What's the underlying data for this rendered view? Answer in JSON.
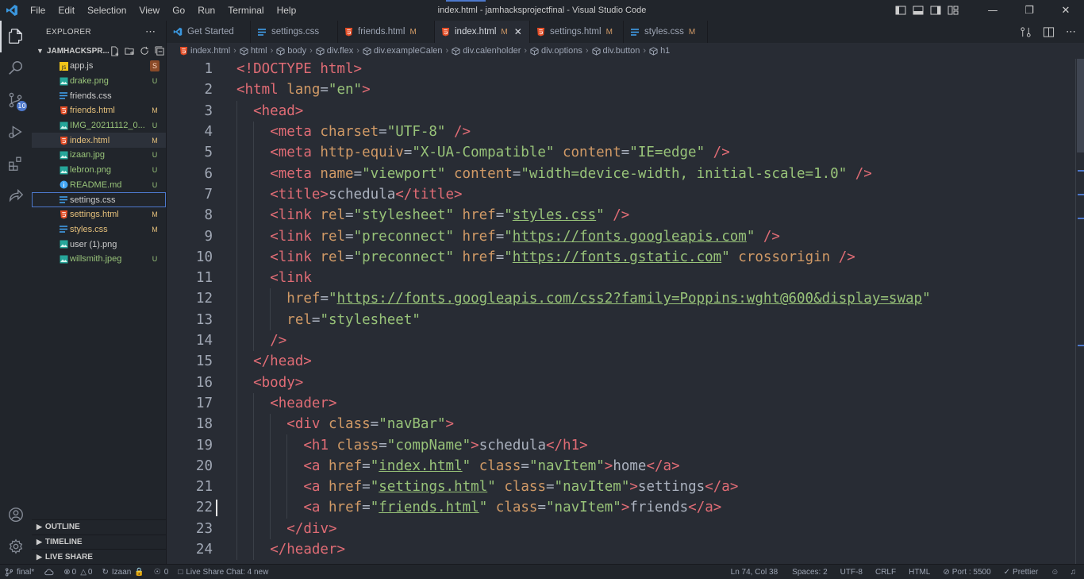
{
  "window": {
    "title": "index.html - jamhacksprojectfinal - Visual Studio Code",
    "menu": [
      "File",
      "Edit",
      "Selection",
      "View",
      "Go",
      "Run",
      "Terminal",
      "Help"
    ]
  },
  "activity": {
    "source_control_badge": "10"
  },
  "sidebar": {
    "title": "EXPLORER",
    "folder": "JAMHACKSPR...",
    "files": [
      {
        "name": "app.js",
        "status": "S",
        "icon": "js-icon",
        "color": "#cccccc"
      },
      {
        "name": "drake.png",
        "status": "U",
        "icon": "image-icon",
        "color": "#98c379"
      },
      {
        "name": "friends.css",
        "status": "",
        "icon": "css-icon",
        "color": "#cccccc"
      },
      {
        "name": "friends.html",
        "status": "M",
        "icon": "html-icon",
        "color": "#e5c07b"
      },
      {
        "name": "IMG_20211112_0...",
        "status": "U",
        "icon": "image-icon",
        "color": "#98c379"
      },
      {
        "name": "index.html",
        "status": "M",
        "icon": "html-icon",
        "color": "#e5c07b"
      },
      {
        "name": "izaan.jpg",
        "status": "U",
        "icon": "image-icon",
        "color": "#98c379"
      },
      {
        "name": "lebron.png",
        "status": "U",
        "icon": "image-icon",
        "color": "#98c379"
      },
      {
        "name": "README.md",
        "status": "U",
        "icon": "info-icon",
        "color": "#98c379"
      },
      {
        "name": "settings.css",
        "status": "",
        "icon": "css-icon",
        "color": "#cccccc"
      },
      {
        "name": "settings.html",
        "status": "M",
        "icon": "html-icon",
        "color": "#e5c07b"
      },
      {
        "name": "styles.css",
        "status": "M",
        "icon": "css-icon",
        "color": "#e5c07b"
      },
      {
        "name": "user (1).png",
        "status": "",
        "icon": "image-icon",
        "color": "#cccccc"
      },
      {
        "name": "willsmith.jpeg",
        "status": "U",
        "icon": "image-icon",
        "color": "#98c379"
      }
    ],
    "sections": [
      "OUTLINE",
      "TIMELINE",
      "LIVE SHARE"
    ]
  },
  "tabs": [
    {
      "label": "Get Started",
      "mod": "",
      "icon": "vscode-icon"
    },
    {
      "label": "settings.css",
      "mod": "",
      "icon": "css-icon"
    },
    {
      "label": "friends.html",
      "mod": "M",
      "icon": "html-icon"
    },
    {
      "label": "index.html",
      "mod": "M",
      "icon": "html-icon",
      "active": true
    },
    {
      "label": "settings.html",
      "mod": "M",
      "icon": "html-icon"
    },
    {
      "label": "styles.css",
      "mod": "M",
      "icon": "css-icon"
    }
  ],
  "breadcrumb": [
    "index.html",
    "html",
    "body",
    "div.flex",
    "div.exampleCalen",
    "div.calenholder",
    "div.options",
    "div.button",
    "h1"
  ],
  "code": [
    {
      "n": "1",
      "i": 0,
      "t": [
        [
          "tag",
          "<!DOCTYPE html>"
        ]
      ]
    },
    {
      "n": "2",
      "i": 0,
      "t": [
        [
          "tag",
          "<html "
        ],
        [
          "attr",
          "lang"
        ],
        [
          "pun",
          "="
        ],
        [
          "str",
          "\"en\""
        ],
        [
          "tag",
          ">"
        ]
      ]
    },
    {
      "n": "3",
      "i": 1,
      "t": [
        [
          "tag",
          "<head>"
        ]
      ]
    },
    {
      "n": "4",
      "i": 2,
      "t": [
        [
          "tag",
          "<meta "
        ],
        [
          "attr",
          "charset"
        ],
        [
          "pun",
          "="
        ],
        [
          "str",
          "\"UTF-8\""
        ],
        [
          "tag",
          " />"
        ]
      ]
    },
    {
      "n": "5",
      "i": 2,
      "t": [
        [
          "tag",
          "<meta "
        ],
        [
          "attr",
          "http-equiv"
        ],
        [
          "pun",
          "="
        ],
        [
          "str",
          "\"X-UA-Compatible\""
        ],
        [
          "pun",
          " "
        ],
        [
          "attr",
          "content"
        ],
        [
          "pun",
          "="
        ],
        [
          "str",
          "\"IE=edge\""
        ],
        [
          "tag",
          " />"
        ]
      ]
    },
    {
      "n": "6",
      "i": 2,
      "t": [
        [
          "tag",
          "<meta "
        ],
        [
          "attr",
          "name"
        ],
        [
          "pun",
          "="
        ],
        [
          "str",
          "\"viewport\""
        ],
        [
          "pun",
          " "
        ],
        [
          "attr",
          "content"
        ],
        [
          "pun",
          "="
        ],
        [
          "str",
          "\"width=device-width, initial-scale=1.0\""
        ],
        [
          "tag",
          " />"
        ]
      ]
    },
    {
      "n": "7",
      "i": 2,
      "t": [
        [
          "tag",
          "<title>"
        ],
        [
          "txt",
          "schedula"
        ],
        [
          "tag",
          "</title>"
        ]
      ]
    },
    {
      "n": "8",
      "i": 2,
      "t": [
        [
          "tag",
          "<link "
        ],
        [
          "attr",
          "rel"
        ],
        [
          "pun",
          "="
        ],
        [
          "str",
          "\"stylesheet\""
        ],
        [
          "pun",
          " "
        ],
        [
          "attr",
          "href"
        ],
        [
          "pun",
          "="
        ],
        [
          "str",
          "\""
        ],
        [
          "strl",
          "styles.css"
        ],
        [
          "str",
          "\""
        ],
        [
          "tag",
          " />"
        ]
      ]
    },
    {
      "n": "9",
      "i": 2,
      "t": [
        [
          "tag",
          "<link "
        ],
        [
          "attr",
          "rel"
        ],
        [
          "pun",
          "="
        ],
        [
          "str",
          "\"preconnect\""
        ],
        [
          "pun",
          " "
        ],
        [
          "attr",
          "href"
        ],
        [
          "pun",
          "="
        ],
        [
          "str",
          "\""
        ],
        [
          "strl",
          "https://fonts.googleapis.com"
        ],
        [
          "str",
          "\""
        ],
        [
          "tag",
          " />"
        ]
      ]
    },
    {
      "n": "10",
      "i": 2,
      "t": [
        [
          "tag",
          "<link "
        ],
        [
          "attr",
          "rel"
        ],
        [
          "pun",
          "="
        ],
        [
          "str",
          "\"preconnect\""
        ],
        [
          "pun",
          " "
        ],
        [
          "attr",
          "href"
        ],
        [
          "pun",
          "="
        ],
        [
          "str",
          "\""
        ],
        [
          "strl",
          "https://fonts.gstatic.com"
        ],
        [
          "str",
          "\""
        ],
        [
          "pun",
          " "
        ],
        [
          "attr",
          "crossorigin"
        ],
        [
          "tag",
          " />"
        ]
      ]
    },
    {
      "n": "11",
      "i": 2,
      "t": [
        [
          "tag",
          "<link"
        ]
      ]
    },
    {
      "n": "12",
      "i": 3,
      "t": [
        [
          "attr",
          "href"
        ],
        [
          "pun",
          "="
        ],
        [
          "str",
          "\""
        ],
        [
          "strl",
          "https://fonts.googleapis.com/css2?family=Poppins:wght@600&display=swap"
        ],
        [
          "str",
          "\""
        ]
      ]
    },
    {
      "n": "13",
      "i": 3,
      "t": [
        [
          "attr",
          "rel"
        ],
        [
          "pun",
          "="
        ],
        [
          "str",
          "\"stylesheet\""
        ]
      ]
    },
    {
      "n": "14",
      "i": 2,
      "t": [
        [
          "tag",
          "/>"
        ]
      ]
    },
    {
      "n": "15",
      "i": 1,
      "t": [
        [
          "tag",
          "</head>"
        ]
      ]
    },
    {
      "n": "16",
      "i": 1,
      "t": [
        [
          "tag",
          "<body>"
        ]
      ]
    },
    {
      "n": "17",
      "i": 2,
      "t": [
        [
          "tag",
          "<header>"
        ]
      ]
    },
    {
      "n": "18",
      "i": 3,
      "t": [
        [
          "tag",
          "<div "
        ],
        [
          "attr",
          "class"
        ],
        [
          "pun",
          "="
        ],
        [
          "str",
          "\"navBar\""
        ],
        [
          "tag",
          ">"
        ]
      ]
    },
    {
      "n": "19",
      "i": 4,
      "t": [
        [
          "tag",
          "<h1 "
        ],
        [
          "attr",
          "class"
        ],
        [
          "pun",
          "="
        ],
        [
          "str",
          "\"compName\""
        ],
        [
          "tag",
          ">"
        ],
        [
          "txt",
          "schedula"
        ],
        [
          "tag",
          "</h1>"
        ]
      ]
    },
    {
      "n": "20",
      "i": 4,
      "t": [
        [
          "tag",
          "<a "
        ],
        [
          "attr",
          "href"
        ],
        [
          "pun",
          "="
        ],
        [
          "str",
          "\""
        ],
        [
          "strl",
          "index.html"
        ],
        [
          "str",
          "\""
        ],
        [
          "pun",
          " "
        ],
        [
          "attr",
          "class"
        ],
        [
          "pun",
          "="
        ],
        [
          "str",
          "\"navItem\""
        ],
        [
          "tag",
          ">"
        ],
        [
          "txt",
          "home"
        ],
        [
          "tag",
          "</a>"
        ]
      ]
    },
    {
      "n": "21",
      "i": 4,
      "t": [
        [
          "tag",
          "<a "
        ],
        [
          "attr",
          "href"
        ],
        [
          "pun",
          "="
        ],
        [
          "str",
          "\""
        ],
        [
          "strl",
          "settings.html"
        ],
        [
          "str",
          "\""
        ],
        [
          "pun",
          " "
        ],
        [
          "attr",
          "class"
        ],
        [
          "pun",
          "="
        ],
        [
          "str",
          "\"navItem\""
        ],
        [
          "tag",
          ">"
        ],
        [
          "txt",
          "settings"
        ],
        [
          "tag",
          "</a>"
        ]
      ]
    },
    {
      "n": "22",
      "i": 4,
      "t": [
        [
          "tag",
          "<a "
        ],
        [
          "attr",
          "href"
        ],
        [
          "pun",
          "="
        ],
        [
          "str",
          "\""
        ],
        [
          "strl",
          "friends.html"
        ],
        [
          "str",
          "\""
        ],
        [
          "pun",
          " "
        ],
        [
          "attr",
          "class"
        ],
        [
          "pun",
          "="
        ],
        [
          "str",
          "\"navItem\""
        ],
        [
          "tag",
          ">"
        ],
        [
          "txt",
          "friends"
        ],
        [
          "tag",
          "</a>"
        ]
      ]
    },
    {
      "n": "23",
      "i": 3,
      "t": [
        [
          "tag",
          "</div>"
        ]
      ]
    },
    {
      "n": "24",
      "i": 2,
      "t": [
        [
          "tag",
          "</header>"
        ]
      ]
    }
  ],
  "status": {
    "branch": "final*",
    "errors": "0",
    "warnings": "0",
    "user": "Izaan",
    "shares": "0",
    "live_share_chat": "Live Share Chat: 4 new",
    "position": "Ln 74, Col 38",
    "spaces": "Spaces: 2",
    "encoding": "UTF-8",
    "eol": "CRLF",
    "language": "HTML",
    "port": "Port : 5500",
    "formatter": "Prettier"
  },
  "colors": {
    "accent": "#4d78cc",
    "html_icon": "#e44d26",
    "css_icon": "#42a5f5",
    "js_icon": "#f0c419",
    "image_icon": "#26a69a"
  }
}
